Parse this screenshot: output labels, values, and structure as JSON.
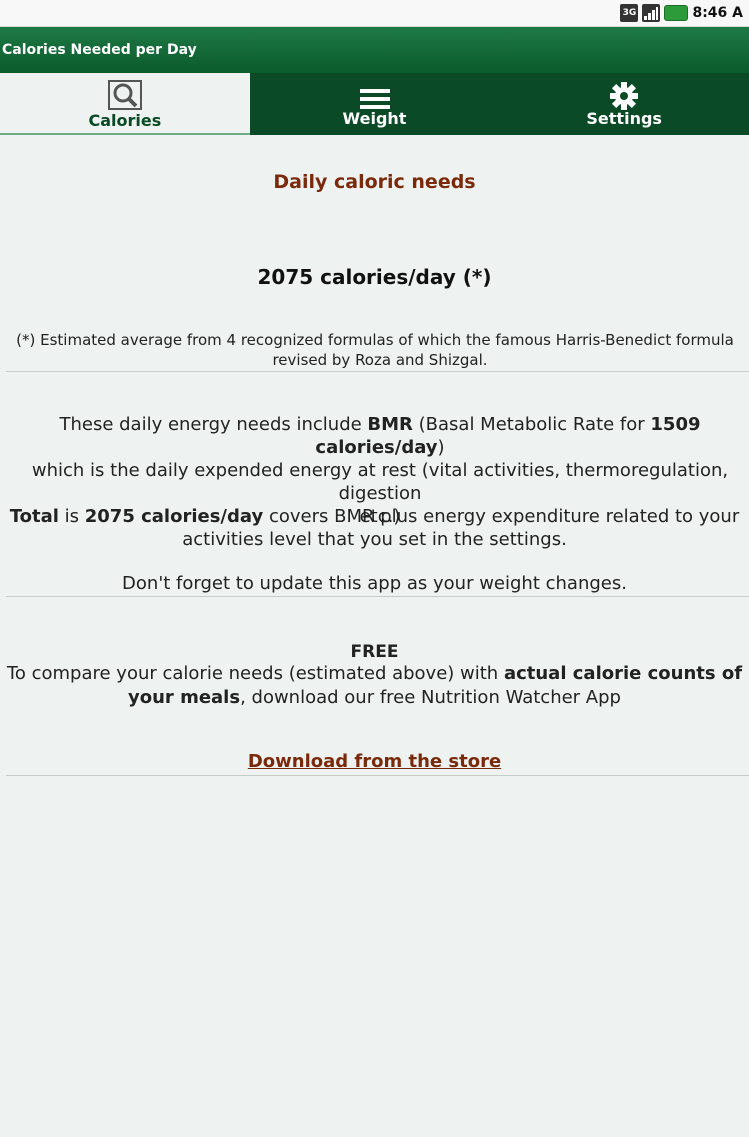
{
  "status_bar": {
    "network": "3G",
    "time": "8:46 A"
  },
  "app": {
    "title": "Calories Needed per Day"
  },
  "tabs": [
    {
      "label": "Calories",
      "icon": "search-icon",
      "active": true
    },
    {
      "label": "Weight",
      "icon": "menu-icon",
      "active": false
    },
    {
      "label": "Settings",
      "icon": "gear-icon",
      "active": false
    }
  ],
  "main": {
    "heading": "Daily caloric needs",
    "calories_per_day": "2075 calories/day (*)",
    "note_line1": "(*) Estimated average from 4 recognized formulas of which the famous Harris-Benedict formula",
    "note_line2": "revised by Roza and Shizgal.",
    "energy_p1_a": "These daily energy needs include ",
    "energy_p1_bmr": "BMR",
    "energy_p1_b": " (Basal Metabolic Rate for ",
    "energy_p1_bmr_value": "1509 calories/day",
    "energy_p1_c": ")",
    "energy_p1_line2": "which is the daily expended energy at rest (vital activities, thermoregulation, digestion",
    "energy_p1_line3": "etc.)",
    "total_label": "Total",
    "total_is": " is ",
    "total_value": "2075 calories/day",
    "total_rest": " covers BMR plus energy expenditure related to your",
    "total_line2": "activities level that you set in the settings.",
    "reminder": "Don't forget to update this app as your weight changes.",
    "free_title": "FREE",
    "free_a": "To compare your calorie needs (estimated above) with ",
    "free_bold1": "actual calorie counts of",
    "free_bold2": "your meals",
    "free_b": ", download our free Nutrition Watcher App",
    "download_link": "Download from the store"
  },
  "colors": {
    "accent": "#0a4a26",
    "heading": "#7a2a0a",
    "background": "#eef2f0"
  }
}
